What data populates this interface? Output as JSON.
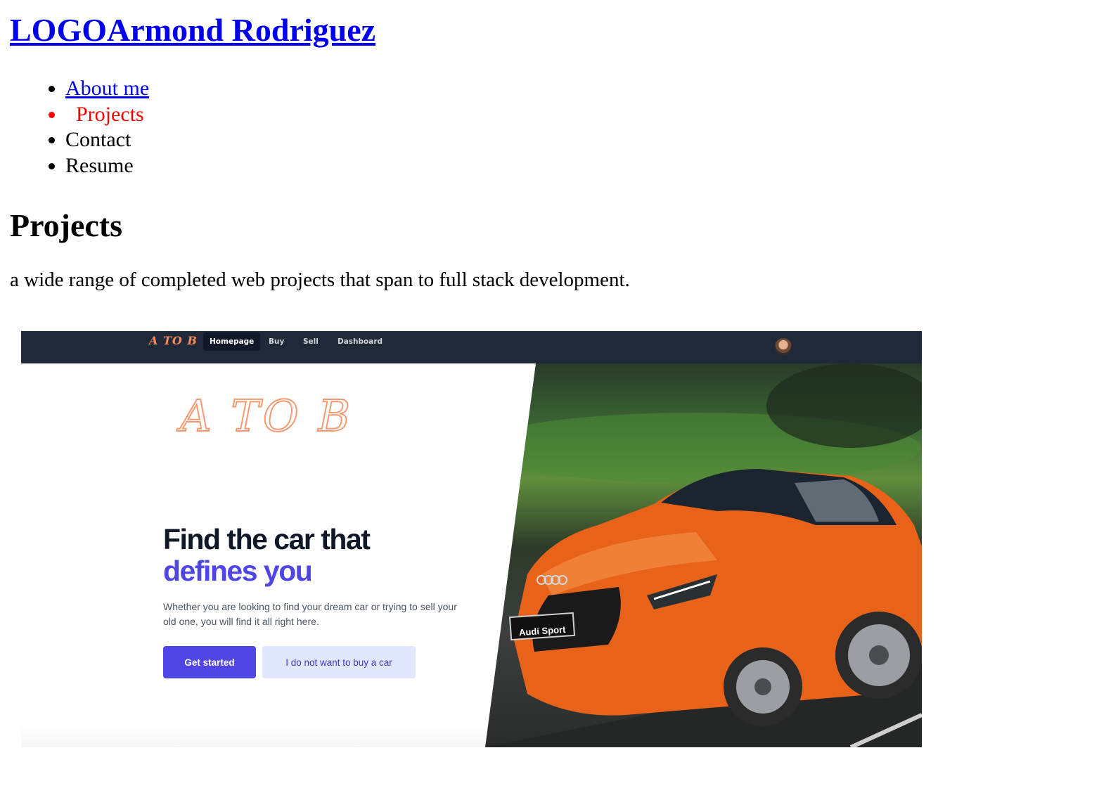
{
  "header": {
    "title": "LOGOArmond Rodriguez"
  },
  "nav": {
    "items": [
      {
        "label": "About me"
      },
      {
        "label": "Projects"
      },
      {
        "label": "Contact"
      },
      {
        "label": "Resume"
      }
    ]
  },
  "projects": {
    "heading": "Projects",
    "description": "a wide range of completed web projects that span to full stack development."
  },
  "project_screenshot": {
    "brand": "A TO B",
    "nav_items": [
      "Homepage",
      "Buy",
      "Sell",
      "Dashboard"
    ],
    "hero_logo": "A TO B",
    "headline": "Find the car that",
    "headline_accent": "defines you",
    "subtitle": "Whether you are looking to find your dream car or trying to sell your old one, you will find it all right here.",
    "primary_button": "Get started",
    "secondary_button": "I do not want to buy a car",
    "plate_text": "Audi Sport"
  },
  "colors": {
    "link": "#0000ee",
    "active_nav": "#ff0000",
    "shot_nav_bg": "#1f2937",
    "accent": "#4f46e5",
    "car": "#e8621a"
  }
}
